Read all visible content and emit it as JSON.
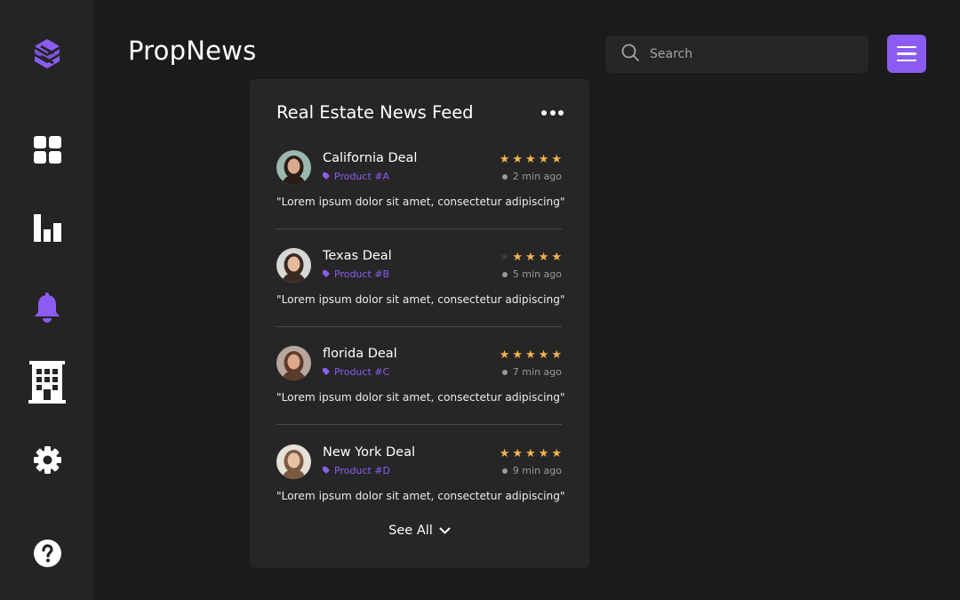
{
  "app": {
    "title": "PropNews"
  },
  "search": {
    "placeholder": "Search"
  },
  "sidebar": {
    "items": [
      {
        "icon": "logo-icon"
      },
      {
        "icon": "grid-icon"
      },
      {
        "icon": "bar-chart-icon"
      },
      {
        "icon": "bell-icon",
        "color": "#8c5cf2"
      },
      {
        "icon": "building-icon"
      },
      {
        "icon": "gear-icon"
      },
      {
        "icon": "help-icon"
      }
    ]
  },
  "colors": {
    "accent": "#8c5cf2",
    "star": "#f7b34a",
    "background": "#1b1b1c",
    "panel": "#262627"
  },
  "feed": {
    "title": "Real Estate News Feed",
    "items": [
      {
        "name": "California Deal",
        "product": "Product #A",
        "time": "2 min ago",
        "rating": 5,
        "text": "\"Lorem ipsum dolor sit amet, consectetur adipiscing\""
      },
      {
        "name": "Texas Deal",
        "product": "Product #B",
        "time": "5 min ago",
        "rating": 4,
        "text": "\"Lorem ipsum dolor sit amet, consectetur adipiscing\""
      },
      {
        "name": "florida Deal",
        "product": "Product #C",
        "time": "7 min ago",
        "rating": 5,
        "text": "\"Lorem ipsum dolor sit amet, consectetur adipiscing\""
      },
      {
        "name": "New York Deal",
        "product": "Product #D",
        "time": "9 min ago",
        "rating": 5,
        "text": "\"Lorem ipsum dolor sit amet, consectetur adipiscing\""
      }
    ],
    "see_all": "See All"
  }
}
